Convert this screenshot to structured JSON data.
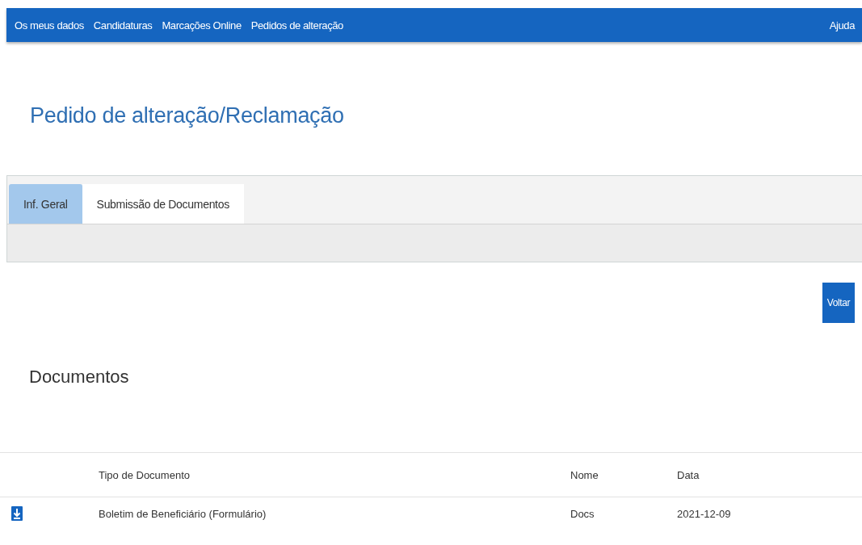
{
  "nav": {
    "items": [
      {
        "label": "Os meus dados"
      },
      {
        "label": "Candidaturas"
      },
      {
        "label": "Marcações Online"
      },
      {
        "label": "Pedidos de alteração"
      }
    ],
    "help": "Ajuda"
  },
  "title": "Pedido de alteração/Reclamação",
  "tabs": [
    {
      "label": "Inf. Geral",
      "selected": true
    },
    {
      "label": "Submissão de Documentos",
      "selected": false
    }
  ],
  "back_button": "Voltar",
  "section_title": "Documentos",
  "table": {
    "columns": [
      "Tipo de Documento",
      "Nome",
      "Data"
    ],
    "rows": [
      {
        "tipo": "Boletim de Beneficiário (Formulário)",
        "nome": "Docs",
        "data": "2021-12-09"
      }
    ]
  }
}
